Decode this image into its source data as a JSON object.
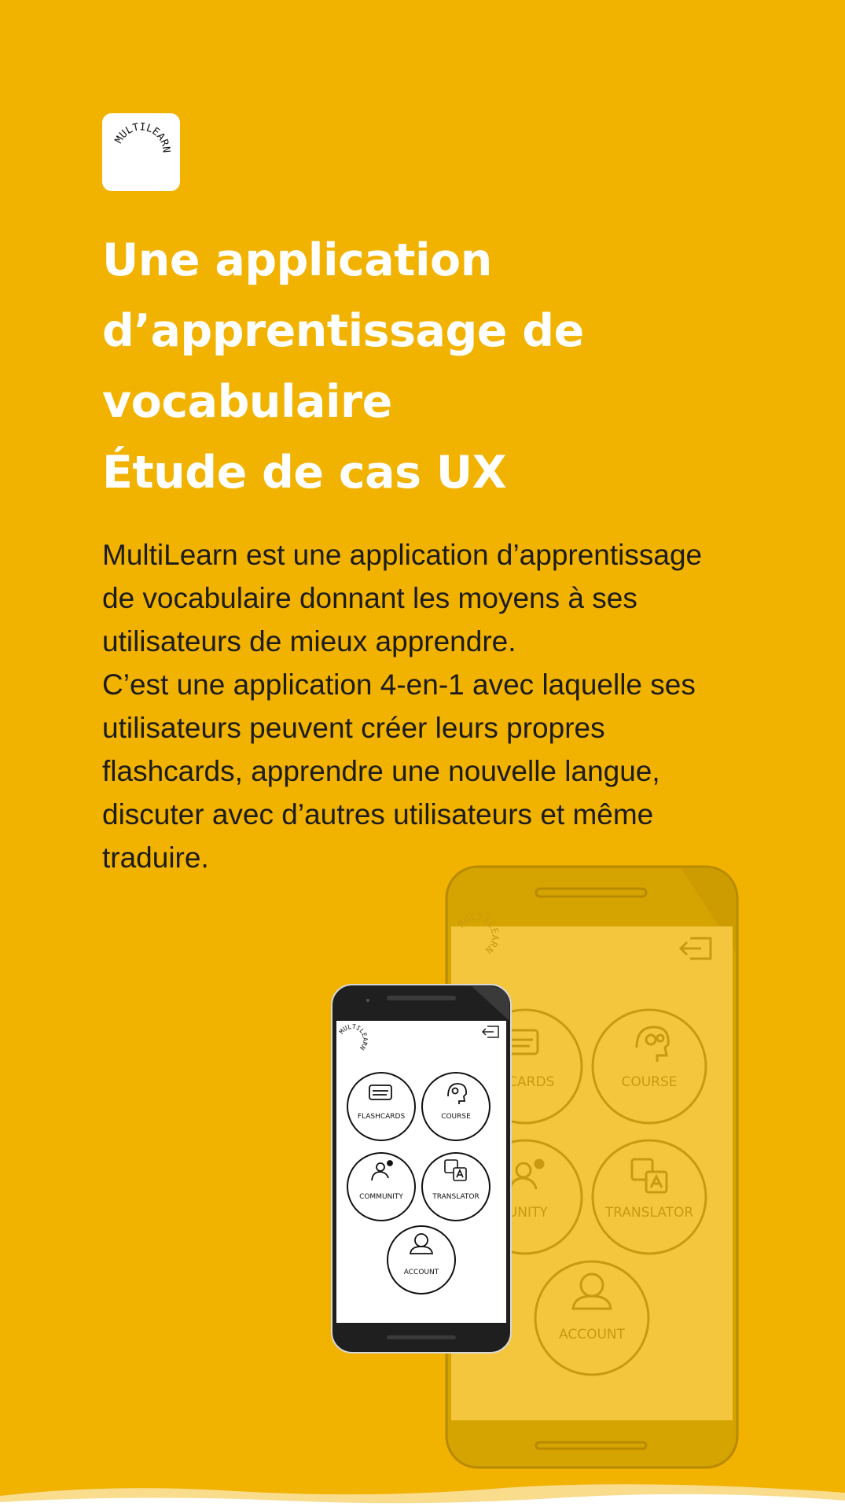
{
  "brand": {
    "logo_text": "MULTILEARN"
  },
  "hero": {
    "title_lines": [
      "Une application",
      "d’apprentissage de",
      "vocabulaire",
      "Étude de cas UX"
    ],
    "description_lines": [
      "MultiLearn est une application d’apprentissage",
      "de vocabulaire donnant les moyens à ses",
      "utilisateurs de mieux apprendre.",
      "C’est une application 4-en-1 avec laquelle ses",
      "utilisateurs peuvent créer leurs propres",
      "flashcards, apprendre une nouvelle langue,",
      "discuter avec d’autres utilisateurs et même",
      "traduire."
    ]
  },
  "phone_small": {
    "menu": [
      {
        "label": "FLASHCARDS",
        "icon": "flashcards-icon"
      },
      {
        "label": "COURSE",
        "icon": "head-gears-icon"
      },
      {
        "label": "COMMUNITY",
        "icon": "people-icon"
      },
      {
        "label": "TRANSLATOR",
        "icon": "translate-icon"
      },
      {
        "label": "ACCOUNT",
        "icon": "user-icon"
      }
    ]
  },
  "phone_big": {
    "menu": [
      {
        "label": "SHCARDS",
        "icon": "flashcards-icon"
      },
      {
        "label": "COURSE",
        "icon": "head-gears-icon"
      },
      {
        "label": "MUNITY",
        "icon": "people-icon"
      },
      {
        "label": "TRANSLATOR",
        "icon": "translate-icon"
      },
      {
        "label": "ACCOUNT",
        "icon": "user-icon"
      }
    ]
  },
  "colors": {
    "background": "#F2B200",
    "title": "#FFFFFF",
    "body_text": "#1C1C1C",
    "phone_faded_frame": "#C99500",
    "phone_faded_screen": "#F4C63E"
  }
}
